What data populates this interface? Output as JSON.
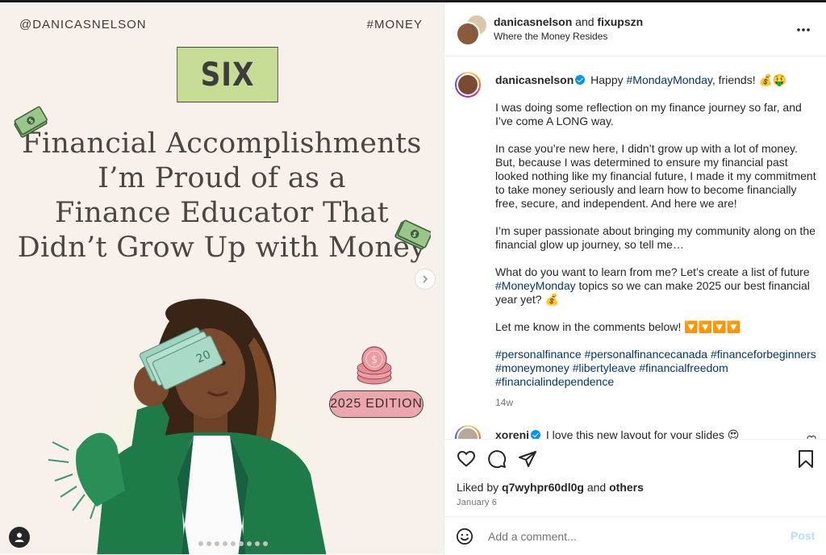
{
  "slide": {
    "handle": "@DANICASNELSON",
    "tag": "#MONEY",
    "number_word": "SIX",
    "headline_lines": [
      "Financial Accomplishments",
      "I’m Proud of as a",
      "Finance Educator That",
      "Didn’t Grow Up with Money"
    ],
    "badge": "2025 EDITION",
    "carousel_dots": 10,
    "active_dot": 0
  },
  "post": {
    "header_user": "danicasnelson",
    "header_and": "and",
    "header_collab": "fixupszn",
    "header_subtitle": "Where the Money Resides",
    "more_icon": "more-horizontal-icon"
  },
  "caption": {
    "username": "danicasnelson",
    "line1_text": "Happy",
    "line1_hashtag": "#MondayMonday",
    "line1_rest": ", friends! 💰🤑",
    "p1": "I was doing some reflection on my finance journey so far, and I’ve come A LONG way.",
    "p2": "In case you’re new here, I didn’t grow up with a lot of money. But, because I was determined to ensure my financial past looked nothing like my financial future, I made it my commitment to take money seriously and learn how to become financially free, secure, and independent. And here we are!",
    "p3": "I’m super passionate about bringing my community along on the financial glow up journey, so tell me…",
    "p4_a": "What do you want to learn from me? Let’s create a list of future",
    "p4_hashtag": "#MoneyMonday",
    "p4_b": "topics so we can make 2025 our best financial year yet? 💰",
    "p5": "Let me know in the comments below! 🔽🔽🔽🔽",
    "hashtags": [
      "#personalfinance",
      "#personalfinancecanada",
      "#financeforbeginners",
      "#moneymoney",
      "#libertyleave",
      "#financialfreedom",
      "#financialindependence"
    ],
    "age": "14w"
  },
  "comment": {
    "username": "xoreni",
    "text": "I love this new layout for your slides 😍"
  },
  "actions": {
    "liked_by_prefix": "Liked by",
    "liked_by_user": "q7wyhpr60dl0g",
    "liked_by_and": "and",
    "liked_by_others": "others",
    "date": "January 6"
  },
  "add_comment": {
    "placeholder": "Add a comment...",
    "post_label": "Post"
  },
  "colors": {
    "slide_bg": "#f8f1eb",
    "six_box": "#c7dd95",
    "edition_badge": "#eca6ad",
    "hashtag": "#00376b",
    "verified": "#0095f6",
    "post_disabled": "#b2dffc"
  }
}
